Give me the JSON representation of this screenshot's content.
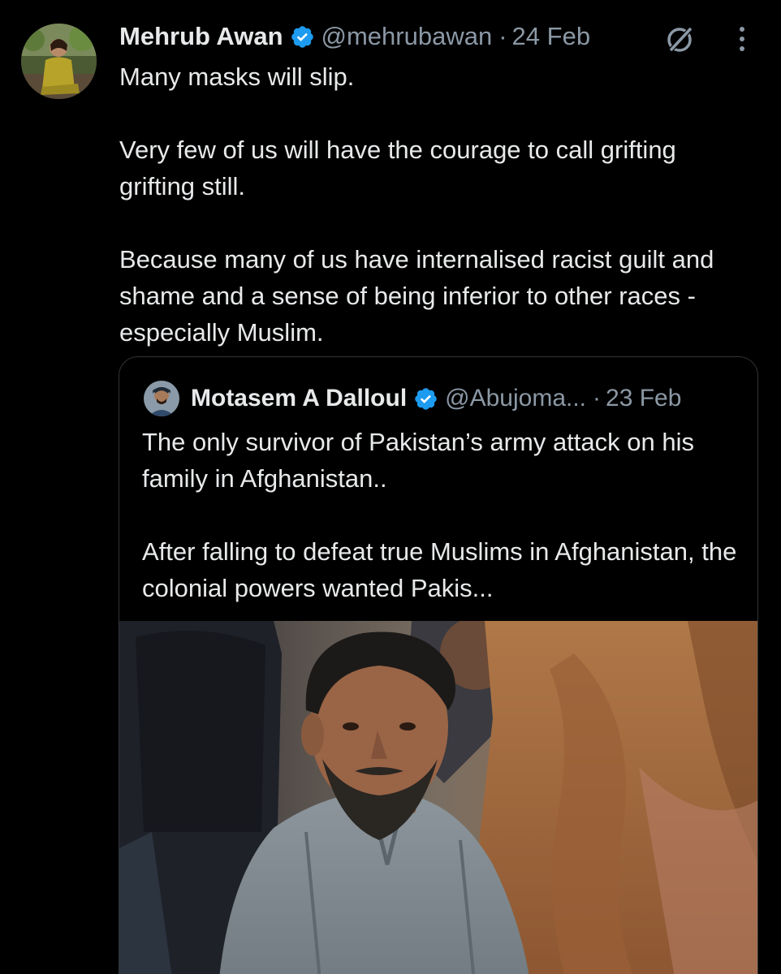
{
  "tweet": {
    "author_name": "Mehrub Awan",
    "handle": "@mehrubawan",
    "separator": "·",
    "date": "24 Feb",
    "paragraphs": [
      "Many masks will slip.",
      "Very few of us will have the courage to call grifting grifting still.",
      "Because many of us have internalised racist guilt and shame and a sense of being inferior to other races - especially Muslim."
    ],
    "icons": {
      "verified": "verified-badge-icon",
      "grok": "grok-icon",
      "more": "more-options-icon"
    }
  },
  "quoted_tweet": {
    "author_name": "Motasem A Dalloul",
    "handle": "@Abujoma...",
    "separator": "·",
    "date": "23 Feb",
    "paragraphs": [
      "The only survivor of Pakistan’s army attack on his family in Afghanistan..",
      "After falling to defeat true Muslims in Afghanistan, the colonial powers wanted Pakis..."
    ]
  },
  "colors": {
    "background": "#000000",
    "text_primary": "#e7e9ea",
    "text_secondary": "#8b98a5",
    "verified_blue": "#1d9bf0",
    "border": "#2f3336"
  }
}
